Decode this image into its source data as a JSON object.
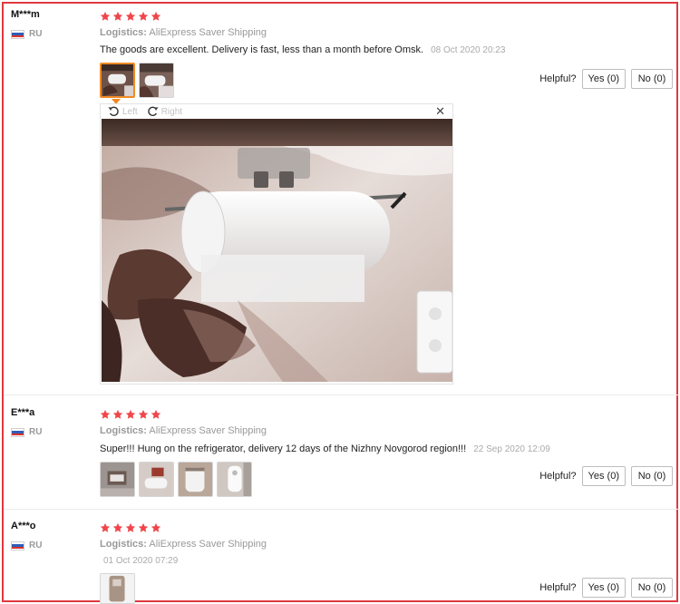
{
  "colors": {
    "accent_border": "#e0393e",
    "star": "#f0464b",
    "active_thumb": "#f08a24",
    "muted": "#999999"
  },
  "reviews": [
    {
      "user": "M***m",
      "country": "RU",
      "stars": 5,
      "logistics_label": "Logistics:",
      "logistics_value": "AliExpress Saver Shipping",
      "text": "The goods are excellent. Delivery is fast, less than a month before Omsk.",
      "date": "08 Oct 2020 20:23",
      "photo_count": 2,
      "helpful_label": "Helpful?",
      "yes_label": "Yes (0)",
      "no_label": "No (0)",
      "viewer": {
        "rotate_left": "Left",
        "rotate_right": "Right",
        "close": "✕",
        "icon_left": "rotate-left-icon",
        "icon_right": "rotate-right-icon"
      }
    },
    {
      "user": "E***a",
      "country": "RU",
      "stars": 5,
      "logistics_label": "Logistics:",
      "logistics_value": "AliExpress Saver Shipping",
      "text": "Super!!! Hung on the refrigerator, delivery 12 days of the Nizhny Novgorod region!!!",
      "date": "22 Sep 2020 12:09",
      "photo_count": 4,
      "helpful_label": "Helpful?",
      "yes_label": "Yes (0)",
      "no_label": "No (0)"
    },
    {
      "user": "A***o",
      "country": "RU",
      "stars": 5,
      "logistics_label": "Logistics:",
      "logistics_value": "AliExpress Saver Shipping",
      "text": "",
      "date": "01 Oct 2020 07:29",
      "photo_count": 1,
      "helpful_label": "Helpful?",
      "yes_label": "Yes (0)",
      "no_label": "No (0)"
    }
  ]
}
